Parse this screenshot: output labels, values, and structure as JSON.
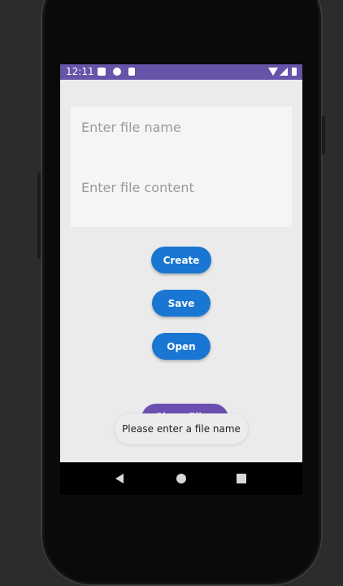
{
  "status_bar": {
    "time": "12:11",
    "icons": [
      "notification-a-icon",
      "notification-p-icon",
      "sd-card-icon",
      "wifi-icon",
      "signal-icon",
      "battery-icon"
    ],
    "color": "#6753a8"
  },
  "form": {
    "file_name_placeholder": "Enter file name",
    "file_content_placeholder": "Enter file content"
  },
  "buttons": {
    "create": "Create",
    "save": "Save",
    "open": "Open",
    "show_files": "Show Files",
    "color": "#1976d2",
    "show_files_color": "#6b4fb0"
  },
  "toast": {
    "message": "Please enter a file name"
  },
  "nav_bar": {
    "items": [
      "back-icon",
      "home-icon",
      "recent-apps-icon"
    ]
  }
}
